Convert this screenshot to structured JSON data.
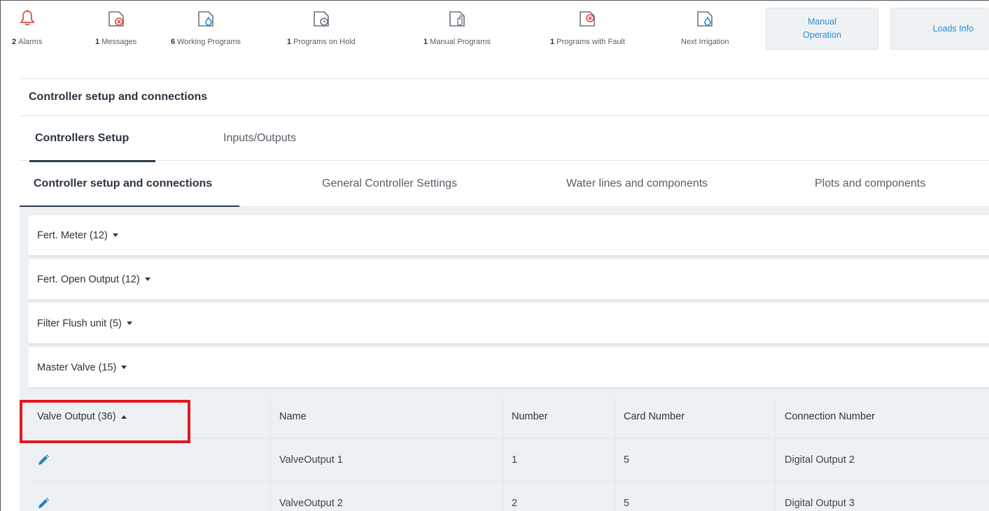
{
  "statusbar": {
    "items": [
      {
        "count": "2",
        "label": "Alarms",
        "icon": "bell-icon"
      },
      {
        "count": "1",
        "label": "Messages",
        "icon": "message-fault-icon"
      },
      {
        "count": "6",
        "label": "Working Programs",
        "icon": "program-drop-icon"
      },
      {
        "count": "1",
        "label": "Programs on Hold",
        "icon": "program-clock-icon"
      },
      {
        "count": "1",
        "label": "Manual Programs",
        "icon": "program-hand-icon"
      },
      {
        "count": "1",
        "label": "Programs with Fault",
        "icon": "program-fault-icon"
      },
      {
        "count": "",
        "label": "Next Irrigation",
        "icon": "next-irrigation-icon"
      }
    ],
    "manual_operation_label_1": "Manual",
    "manual_operation_label_2": "Operation",
    "loads_info_label": "Loads Info"
  },
  "section_title": "Controller setup and connections",
  "main_tabs": [
    {
      "label": "Controllers Setup",
      "active": true
    },
    {
      "label": "Inputs/Outputs",
      "active": false
    }
  ],
  "sub_tabs": [
    {
      "label": "Controller setup and connections",
      "active": true
    },
    {
      "label": "General Controller Settings",
      "active": false
    },
    {
      "label": "Water lines and components",
      "active": false
    },
    {
      "label": "Plots and components",
      "active": false
    }
  ],
  "accordions": [
    {
      "label": "Fert. Meter (12)",
      "expanded": false
    },
    {
      "label": "Fert. Open Output (12)",
      "expanded": false
    },
    {
      "label": "Filter Flush unit (5)",
      "expanded": false
    },
    {
      "label": "Master Valve (15)",
      "expanded": false
    },
    {
      "label": "Valve Output (36)",
      "expanded": true
    }
  ],
  "valve_table": {
    "headers": [
      "Name",
      "Number",
      "Card Number",
      "Connection Number"
    ],
    "rows": [
      {
        "name": "ValveOutput 1",
        "number": "1",
        "card": "5",
        "connection": "Digital Output 2"
      },
      {
        "name": "ValveOutput 2",
        "number": "2",
        "card": "5",
        "connection": "Digital Output 3"
      }
    ]
  },
  "colors": {
    "alarm_red": "#e84545",
    "fault_red": "#e84545",
    "icon_gray": "#6a737c",
    "icon_blue": "#2d8ccf",
    "link_blue": "#2d8ccf",
    "highlight_red": "#e0191f",
    "edit_blue": "#1f7fc6"
  }
}
